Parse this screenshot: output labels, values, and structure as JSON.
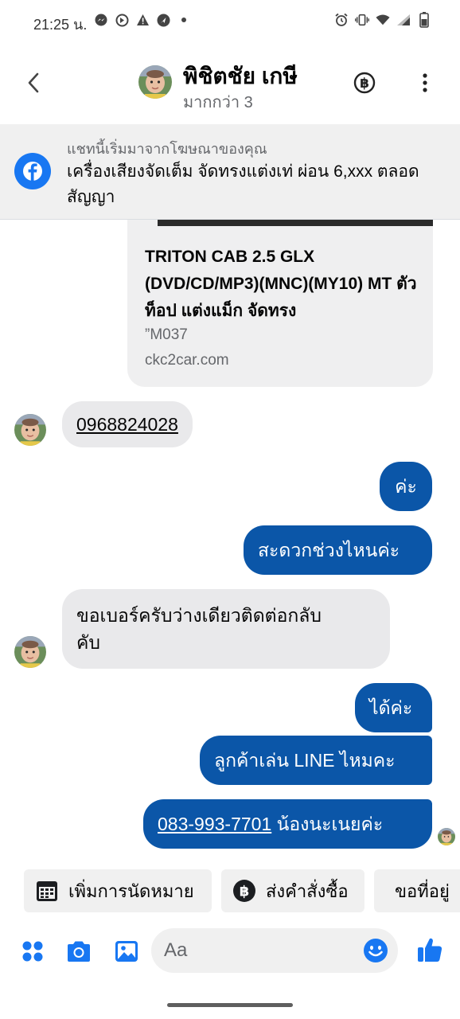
{
  "statusbar": {
    "time": "21:25 น.",
    "left_icons": [
      "messenger-icon",
      "data-saver-icon",
      "warning-icon",
      "navigation-icon",
      "dot-icon"
    ],
    "right_icons": [
      "alarm-icon",
      "vibrate-icon",
      "wifi-icon",
      "signal-icon",
      "battery-icon"
    ]
  },
  "header": {
    "name": "พิชิตชัย เกษี",
    "subtitle": "มากกว่า 3"
  },
  "ad_banner": {
    "title": "แชทนี้เริ่มมาจากโฆษณาของคุณ",
    "text": "เครื่องเสียงจัดเต็ม จัดทรงแต่งเท่ ผ่อน 6,xxx ตลอดสัญญา"
  },
  "link_card": {
    "title": "TRITON CAB 2.5 GLX (DVD/CD/MP3)(MNC)(MY10) MT ตัวท็อป แต่งแม็ก จัดทรง",
    "description": "”M037",
    "domain": "ckc2car.com"
  },
  "messages": [
    {
      "sender": "them",
      "text": "0968824028"
    },
    {
      "sender": "me",
      "text": "ค่ะ"
    },
    {
      "sender": "me",
      "text": "สะดวกช่วงไหนค่ะ"
    },
    {
      "sender": "them",
      "text": "ขอเบอร์ครับว่างเดียวติดต่อกลับ",
      "text_line2": "คับ"
    },
    {
      "sender": "me",
      "text": "ได้ค่ะ"
    },
    {
      "sender": "me",
      "text": "ลูกค้าเล่น LINE ไหมคะ"
    },
    {
      "sender": "me",
      "phone": "083-993-7701",
      "text": " น้องนะเนยค่ะ"
    }
  ],
  "quick_actions": [
    {
      "label": "เพิ่มการนัดหมาย",
      "icon": "calendar-icon"
    },
    {
      "label": "ส่งคำสั่งซื้อ",
      "icon": "baht-icon"
    },
    {
      "label": "ขอที่อยู่",
      "icon": "map-icon"
    }
  ],
  "composer": {
    "placeholder": "Aa"
  },
  "colors": {
    "outgoing_bubble": "#0b56a8",
    "incoming_bubble": "#e9e9eb",
    "accent": "#1877f2"
  }
}
